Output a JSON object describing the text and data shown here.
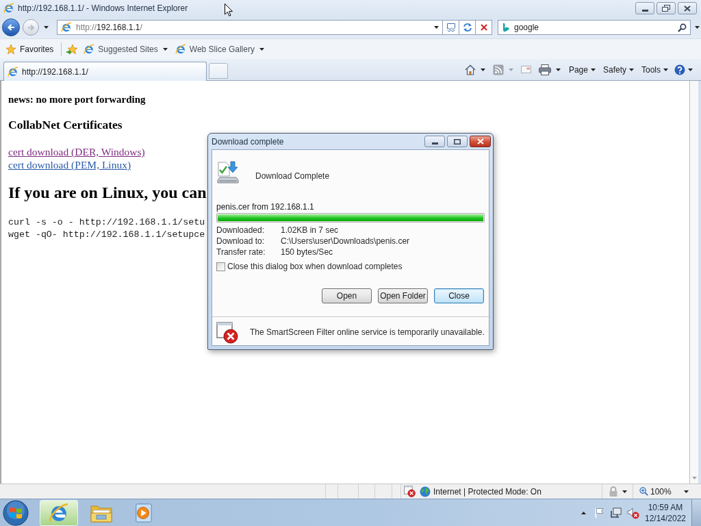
{
  "window": {
    "title": "http://192.168.1.1/ - Windows Internet Explorer"
  },
  "navigation": {
    "back": {
      "disabled": false
    },
    "forward": {
      "disabled": true
    },
    "url": [
      "http://",
      "192.168.1.1",
      "/"
    ]
  },
  "search": {
    "value": "google"
  },
  "favorites_bar": {
    "label": "Favorites",
    "items": [
      {
        "label": "Suggested Sites"
      },
      {
        "label": "Web Slice Gallery"
      }
    ]
  },
  "tabs": [
    {
      "label": "http://192.168.1.1/",
      "selected": true
    }
  ],
  "command_bar": {
    "tools": [
      {
        "kind": "home",
        "disabled": false
      },
      {
        "kind": "feeds",
        "disabled": true
      },
      {
        "kind": "mail",
        "disabled": true
      },
      {
        "kind": "print",
        "disabled": false
      }
    ],
    "menus": [
      {
        "label": "Page"
      },
      {
        "label": "Safety"
      },
      {
        "label": "Tools"
      }
    ]
  },
  "page": {
    "news": "news: no more port forwarding",
    "heading": "CollabNet Certificates",
    "links": [
      {
        "label": "cert download (DER, Windows)",
        "visited": true
      },
      {
        "label": "cert download (PEM, Linux)",
        "visited": false
      }
    ],
    "linux_heading": "If you are on Linux, you can",
    "code_lines": [
      "curl -s -o - http://192.168.1.1/setu",
      "wget -qO- http://192.168.1.1/setupce"
    ]
  },
  "dialog": {
    "title": "Download complete",
    "heading": "Download Complete",
    "file": "penis.cer from 192.168.1.1",
    "progress": {
      "level": 1
    },
    "details": [
      {
        "label": "Downloaded:",
        "value": "1.02KB in 7 sec"
      },
      {
        "label": "Download to:",
        "value": "C:\\Users\\user\\Downloads\\penis.cer"
      },
      {
        "label": "Transfer rate:",
        "value": "150 bytes/Sec"
      }
    ],
    "close_when_done": {
      "label": "Close this dialog box when download completes",
      "checked": false
    },
    "buttons": [
      {
        "label": "Open",
        "default": false
      },
      {
        "label": "Open Folder",
        "default": false
      },
      {
        "label": "Close",
        "default": true
      }
    ],
    "notice": "The SmartScreen Filter online service is temporarily unavailable."
  },
  "status_bar": {
    "zone": "Internet | Protected Mode: On",
    "zoom": "100%"
  },
  "taskbar": {
    "apps": [
      {
        "kind": "browser",
        "selected": true
      },
      {
        "kind": "folder",
        "selected": false
      },
      {
        "kind": "media",
        "selected": false
      }
    ],
    "time": "10:59 AM",
    "date": "12/14/2022"
  }
}
